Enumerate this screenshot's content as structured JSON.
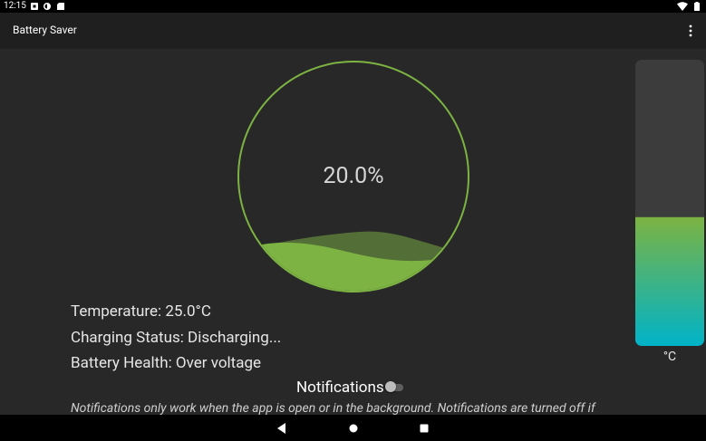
{
  "status_bar": {
    "time": "12:15",
    "left_icons": [
      "notification-square-icon",
      "notification-circle-icon",
      "sd-card-icon"
    ],
    "right_icons": [
      "wifi-icon",
      "battery-icon"
    ]
  },
  "app_bar": {
    "title": "Battery Saver",
    "menu_icon": "overflow-menu-icon"
  },
  "battery_gauge": {
    "percent_text": "20.0%",
    "level": 0.2,
    "ring_color": "#7cb342",
    "fill_color": "#7cb342"
  },
  "thermometer": {
    "unit": "°C",
    "level": 0.45,
    "gradient_top": "#7cb342",
    "gradient_bottom": "#00b3c8"
  },
  "info": {
    "temperature": "Temperature: 25.0°C",
    "charging_status": "Charging Status: Discharging...",
    "battery_health": "Battery Health: Over voltage"
  },
  "notifications": {
    "label": "Notifications",
    "enabled": false,
    "note": "Notifications only work when the app is open or in the background. Notifications are turned off if"
  },
  "nav_bar": {
    "icons": [
      "back-icon",
      "home-icon",
      "recents-icon"
    ]
  }
}
